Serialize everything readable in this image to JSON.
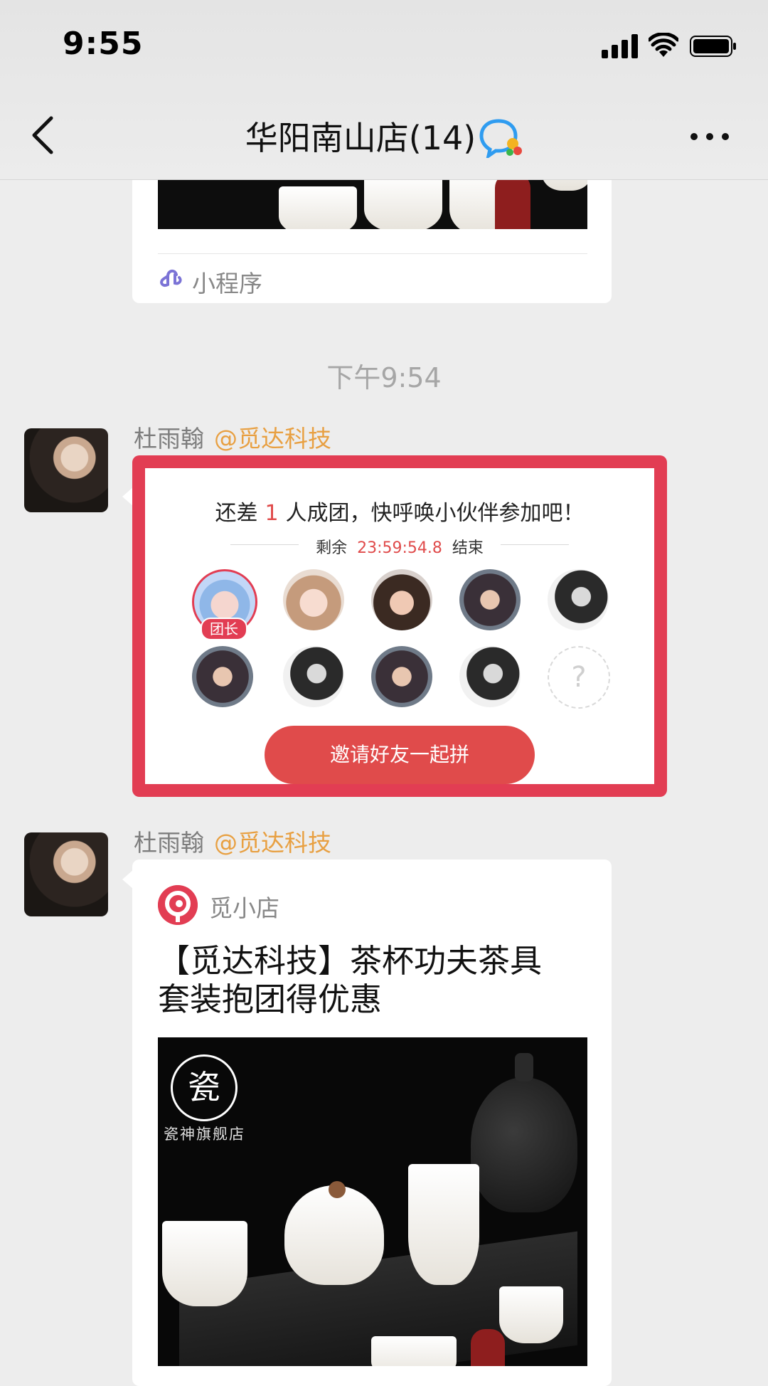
{
  "status_bar": {
    "time": "9:55"
  },
  "nav": {
    "title": "华阳南山店(14)"
  },
  "messages": {
    "mini_program_label": "小程序",
    "timestamp": "下午9:54",
    "group_buy": {
      "sender": "杜雨翰",
      "mention": "@觅达科技",
      "title_pre": "还差",
      "title_num": "1",
      "title_post": "人成团，快呼唤小伙伴参加吧！",
      "timer_pre": "剩余",
      "timer_value": "23:59:54.8",
      "timer_post": "结束",
      "leader_badge": "团长",
      "empty_slot": "?",
      "invite_button": "邀请好友一起拼"
    },
    "shop_card": {
      "sender": "杜雨翰",
      "mention": "@觅达科技",
      "shop_name": "觅小店",
      "title_line1": "【觅达科技】茶杯功夫茶具",
      "title_line2": "套装抱团得优惠",
      "brand_char": "瓷",
      "brand_text": "瓷神旗舰店"
    }
  },
  "colors": {
    "accent_red": "#e23d53",
    "mention_orange": "#e8a042",
    "timer_red": "#e04b4b"
  }
}
